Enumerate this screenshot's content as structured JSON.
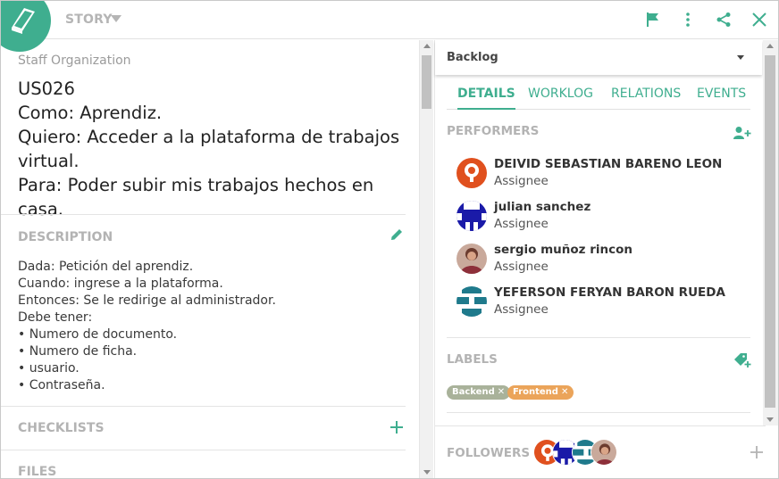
{
  "header": {
    "type_label": "STORY",
    "icons": [
      "book-icon",
      "flag-icon",
      "more-vertical-icon",
      "share-icon",
      "close-icon"
    ]
  },
  "story": {
    "project": "Staff Organization",
    "title": "US026\nComo: Aprendiz.\nQuiero: Acceder a la plataforma de trabajos virtual.\nPara: Poder subir mis trabajos hechos en casa."
  },
  "description": {
    "label": "DESCRIPTION",
    "text": "Dada: Petición del aprendiz.\nCuando: ingrese a la plataforma.\nEntonces: Se le redirige al administrador.\nDebe tener:\n• Numero de documento.\n• Numero de ficha.\n• usuario.\n• Contraseña."
  },
  "checklists": {
    "label": "CHECKLISTS"
  },
  "files": {
    "label": "FILES"
  },
  "status": {
    "label": "Backlog"
  },
  "tabs": [
    {
      "label": "DETAILS",
      "active": true
    },
    {
      "label": "WORKLOG",
      "active": false
    },
    {
      "label": "RELATIONS",
      "active": false
    },
    {
      "label": "EVENTS",
      "active": false
    }
  ],
  "performers": {
    "label": "PERFORMERS",
    "people": [
      {
        "name": "DEIVID SEBASTIAN BARENO LEON",
        "role": "Assignee"
      },
      {
        "name": "julian sanchez",
        "role": "Assignee"
      },
      {
        "name": "sergio muñoz rincon",
        "role": "Assignee"
      },
      {
        "name": "YEFERSON FERYAN BARON RUEDA",
        "role": "Assignee"
      }
    ]
  },
  "labels": {
    "label": "LABELS",
    "tags": [
      {
        "text": "Backend",
        "color": "#a9b29a"
      },
      {
        "text": "Frontend",
        "color": "#eba45a"
      }
    ]
  },
  "followers": {
    "label": "FOLLOWERS"
  },
  "colors": {
    "accent": "#3fae8f",
    "muted": "#b3b3b3"
  }
}
